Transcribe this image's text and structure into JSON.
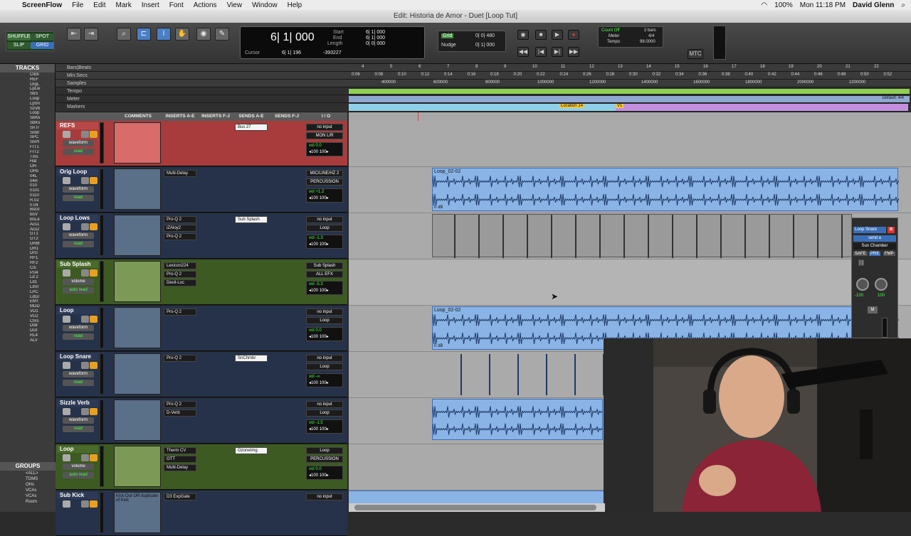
{
  "menubar": {
    "app_name": "ScreenFlow",
    "items": [
      "File",
      "Edit",
      "Mark",
      "Insert",
      "Font",
      "Actions",
      "View",
      "Window",
      "Help"
    ],
    "battery": "100%",
    "clock": "Mon 11:18 PM",
    "user": "David Glenn"
  },
  "window": {
    "title": "Edit: Historia de Amor - Duet [Loop Tut]"
  },
  "edit_modes": {
    "shuffle": "SHUFFLE",
    "spot": "SPOT",
    "slip": "SLIP",
    "grid": "GRID"
  },
  "counter": {
    "main": "6| 1| 000",
    "start_label": "Start",
    "end_label": "End",
    "length_label": "Length",
    "start": "6| 1| 000",
    "end": "6| 1| 000",
    "length": "0| 0| 000",
    "cursor_label": "Cursor",
    "cursor": "6| 1| 196",
    "sample": "-393227"
  },
  "grid_nudge": {
    "grid_label": "Grid",
    "grid_value": "0| 0| 480",
    "nudge_label": "Nudge",
    "nudge_value": "0| 1| 000"
  },
  "count_off": {
    "count_off": "Count Off",
    "bars": "2 bars",
    "meter": "Meter",
    "meter_value": "4/4",
    "tempo": "Tempo",
    "tempo_value": "98.0000"
  },
  "mtc": "MTC",
  "tracks_panel": {
    "header": "TRACKS",
    "items": [
      "Click",
      "REF",
      "OrgL",
      "LpLw",
      "SbS",
      "Loop",
      "LpSn",
      "SzVb",
      "Loop",
      "SbKk",
      "SbKs",
      "SnTr",
      "SnBr",
      "SPC",
      "SnPt",
      "FrT1",
      "FrT2",
      "Tms",
      "Hat",
      "OH",
      "OHs",
      "04L",
      "04R",
      "010",
      "0101",
      "0110",
      "R.02",
      "0.04",
      "BsGt",
      "BsV",
      "BsLe",
      "Acs1",
      "Acs2",
      "GT1",
      "GT2",
      "DRM",
      "DR1",
      "DrG",
      "RF1",
      "RF2",
      "Cls",
      "P.04",
      "Ld 2",
      "Ld1",
      "LdVr",
      "LPC",
      "LdGr",
      "EMT",
      "MDD",
      "VD1",
      "VD2",
      "Chrs",
      "Ddir",
      "DDI",
      "RL4",
      "ALV"
    ]
  },
  "groups_panel": {
    "header": "GROUPS",
    "items": [
      "<ALL>",
      "TOMS",
      "OHs",
      "VCAs",
      "VCAs",
      "Room"
    ]
  },
  "rulers": {
    "bars_beats": {
      "label": "Bars|Beats",
      "ticks": [
        "4",
        "5",
        "6",
        "7",
        "8",
        "9",
        "10",
        "11",
        "12",
        "13",
        "14",
        "15",
        "16",
        "17",
        "18",
        "19",
        "20",
        "21",
        "22"
      ]
    },
    "min_secs": {
      "label": "Min:Secs",
      "ticks": [
        "0:06",
        "0:08",
        "0:10",
        "0:12",
        "0:14",
        "0:16",
        "0:18",
        "0:20",
        "0:22",
        "0:24",
        "0:26",
        "0:28",
        "0:30",
        "0:32",
        "0:34",
        "0:36",
        "0:38",
        "0:40",
        "0:42",
        "0:44",
        "0:46",
        "0:48",
        "0:50",
        "0:52"
      ]
    },
    "samples": {
      "label": "Samples",
      "ticks": [
        "400000",
        "600000",
        "800000",
        "1000000",
        "1200000",
        "1400000",
        "1600000",
        "1800000",
        "2000000",
        "2200000"
      ]
    },
    "tempo": {
      "label": "Tempo"
    },
    "meter": {
      "label": "Meter",
      "default": "Default: 4/4"
    },
    "markers": {
      "label": "Markers",
      "items": [
        "Location 14",
        "V1"
      ]
    }
  },
  "columns": [
    "COMMENTS",
    "INSERTS A-E",
    "INSERTS F-J",
    "SENDS A-E",
    "SENDS F-J",
    "I / O"
  ],
  "tracks": [
    {
      "name": "REFS",
      "view": "waveform",
      "mode": "read",
      "inserts_a": [],
      "sends": [
        "Bus 27"
      ],
      "io": [
        "no input",
        "MON L/R"
      ],
      "vol": "vol   0.0",
      "pan": "◂100  100▸"
    },
    {
      "name": "Orig Loop",
      "view": "waveform",
      "mode": "read",
      "inserts_a": [
        "Multi-Delay"
      ],
      "sends": [],
      "io": [
        "MIC/LINE/HZ 2",
        "PERCUSSION"
      ],
      "vol": "vol  +1.2",
      "pan": "◂100  100▸"
    },
    {
      "name": "Loop Lows",
      "view": "waveform",
      "mode": "read",
      "inserts_a": [
        "Pro-Q 2",
        "iZAloy2",
        "Pro-Q 2"
      ],
      "sends": [
        "Sub Splash"
      ],
      "io": [
        "no input",
        "Loop"
      ],
      "vol": "vol  -1.3",
      "pan": "◂100  100▸"
    },
    {
      "name": "Sub Splash",
      "view": "volume",
      "mode": "auto read",
      "inserts_a": [
        "Lexicon224",
        "Pro-Q 2",
        "Devil-Loc"
      ],
      "sends": [],
      "io": [
        "Sub Splash",
        "ALL EFX"
      ],
      "vol": "vol  -5.3",
      "pan": "◂100  100▸"
    },
    {
      "name": "Loop",
      "view": "waveform",
      "mode": "read",
      "inserts_a": [
        "Pro-Q 2"
      ],
      "sends": [],
      "io": [
        "no input",
        "Loop"
      ],
      "vol": "vol   0.0",
      "pan": "◂100  100▸"
    },
    {
      "name": "Loop Snare",
      "view": "waveform",
      "mode": "read",
      "inserts_a": [
        "Pro-Q 2"
      ],
      "sends": [
        "SnChmbr"
      ],
      "io": [
        "no input",
        "Loop"
      ],
      "vol": "vol   -∞",
      "pan": "◂100  100▸"
    },
    {
      "name": "Sizzle Verb",
      "view": "waveform",
      "mode": "read",
      "inserts_a": [
        "Pro-Q 2",
        "D-Verb"
      ],
      "sends": [],
      "io": [
        "no input",
        "Loop"
      ],
      "vol": "vol  -1.5",
      "pan": "◂100  100▸"
    },
    {
      "name": "Loop",
      "view": "volume",
      "mode": "auto read",
      "inserts_a": [
        "Therm CV",
        "OTT",
        "Multi-Delay"
      ],
      "sends": [
        "OzoneImg"
      ],
      "io": [
        "Loop",
        "PERCUSSION"
      ],
      "vol": "vol   0.0",
      "pan": "◂100  100▸"
    },
    {
      "name": "Sub Kick",
      "view": "",
      "mode": "",
      "comment": "Kick Out OR duplicate of Kick",
      "inserts_a": [
        "D3 ExpGate"
      ],
      "sends": [],
      "io": [
        "no input"
      ],
      "vol": "",
      "pan": ""
    }
  ],
  "clips": [
    {
      "name": "Loop_02-02",
      "gain": "0 dB"
    },
    {
      "name": "Loop_02-02",
      "gain": "0 dB"
    }
  ],
  "send_window": {
    "track": "Loop Snare",
    "send": "send a",
    "dest": "Sun Chamber",
    "safe": "SAFE",
    "pre": "PRE",
    "fmp": "FMP",
    "pan_l": "-100",
    "pan_r": "100",
    "m": "M"
  }
}
